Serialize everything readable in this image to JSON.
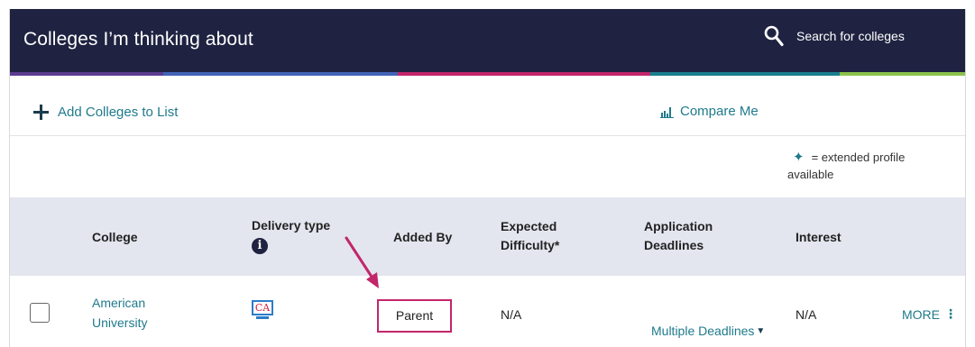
{
  "header": {
    "title": "Colleges I’m thinking about",
    "search_label": "Search for colleges",
    "search_icon": "search-icon",
    "stripe_colors": [
      "#5a3d91",
      "#4263b8",
      "#c2266b",
      "#1a7f8e",
      "#8bc34a"
    ]
  },
  "actions": {
    "add_label": "Add Colleges to List",
    "compare_label": "Compare Me"
  },
  "legend": {
    "symbol": "✦",
    "line1": "= extended profile",
    "line2": "available"
  },
  "table": {
    "columns": {
      "college": "College",
      "delivery": "Delivery type",
      "added_by": "Added By",
      "difficulty_1": "Expected",
      "difficulty_2": "Difficulty*",
      "deadlines_1": "Application",
      "deadlines_2": "Deadlines",
      "interest": "Interest"
    },
    "rows": [
      {
        "college_1": "American",
        "college_2": "University",
        "delivery_icon_text": "CA",
        "added_by": "Parent",
        "difficulty": "N/A",
        "deadlines": "Multiple Deadlines",
        "interest": "N/A",
        "more": "MORE"
      }
    ]
  },
  "colors": {
    "header_bg": "#1f2341",
    "accent": "#1f7a8c",
    "highlight": "#c2266b",
    "table_header_bg": "#e3e6ef"
  }
}
